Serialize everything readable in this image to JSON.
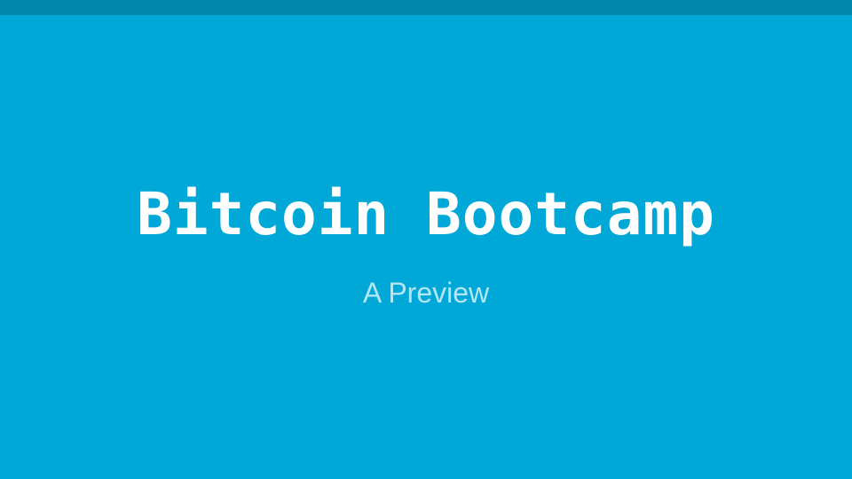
{
  "slide": {
    "title": "Bitcoin Bootcamp",
    "subtitle": "A Preview"
  },
  "colors": {
    "background": "#00a8d8",
    "top_bar": "#0087ad",
    "title_text": "#ffffff",
    "subtitle_text": "#b3e6f5"
  }
}
